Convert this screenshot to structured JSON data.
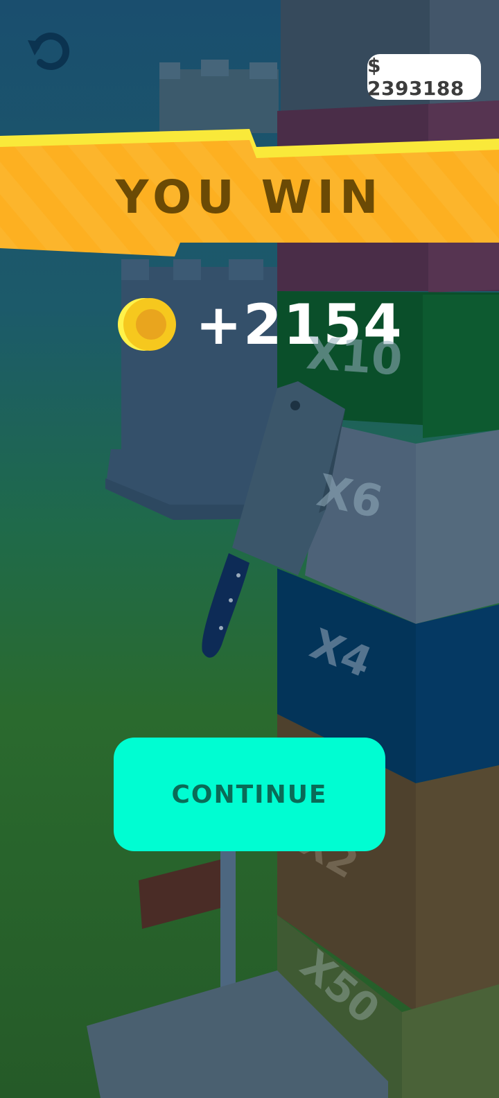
{
  "hud": {
    "money": "$ 2393188",
    "restart_icon": "restart-icon"
  },
  "result": {
    "title": "YOU WIN",
    "coin_icon": "coin-icon",
    "reward": "+2154"
  },
  "tower": {
    "multipliers": [
      "X10",
      "X6",
      "X4",
      "X2",
      "X50"
    ]
  },
  "actions": {
    "continue_label": "CONTINUE"
  },
  "colors": {
    "banner": "#fdb021",
    "continue_bg": "#00fdd2",
    "continue_text": "#0a6b57",
    "coin": "#f6c81e"
  }
}
